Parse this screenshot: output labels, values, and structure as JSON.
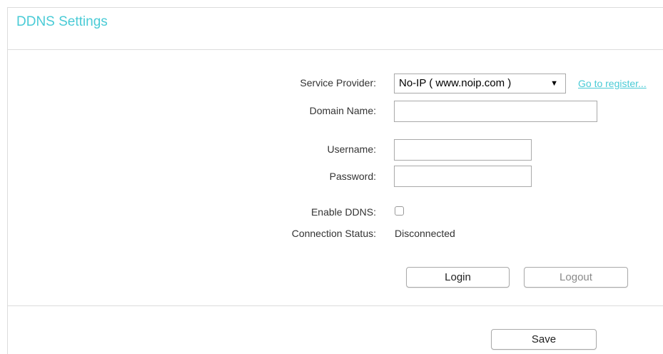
{
  "header": {
    "title": "DDNS Settings"
  },
  "form": {
    "service_provider": {
      "label": "Service Provider:",
      "selected": "No-IP ( www.noip.com )",
      "register_link": "Go to register..."
    },
    "domain_name": {
      "label": "Domain Name:",
      "value": ""
    },
    "username": {
      "label": "Username:",
      "value": ""
    },
    "password": {
      "label": "Password:",
      "value": ""
    },
    "enable_ddns": {
      "label": "Enable DDNS:",
      "checked": false
    },
    "connection_status": {
      "label": "Connection Status:",
      "value": "Disconnected"
    }
  },
  "buttons": {
    "login": "Login",
    "logout": "Logout",
    "save": "Save"
  },
  "colors": {
    "accent": "#4acbd6",
    "border": "#dcdcdc"
  },
  "icons": {
    "dropdown": "dropdown-arrow-icon"
  }
}
